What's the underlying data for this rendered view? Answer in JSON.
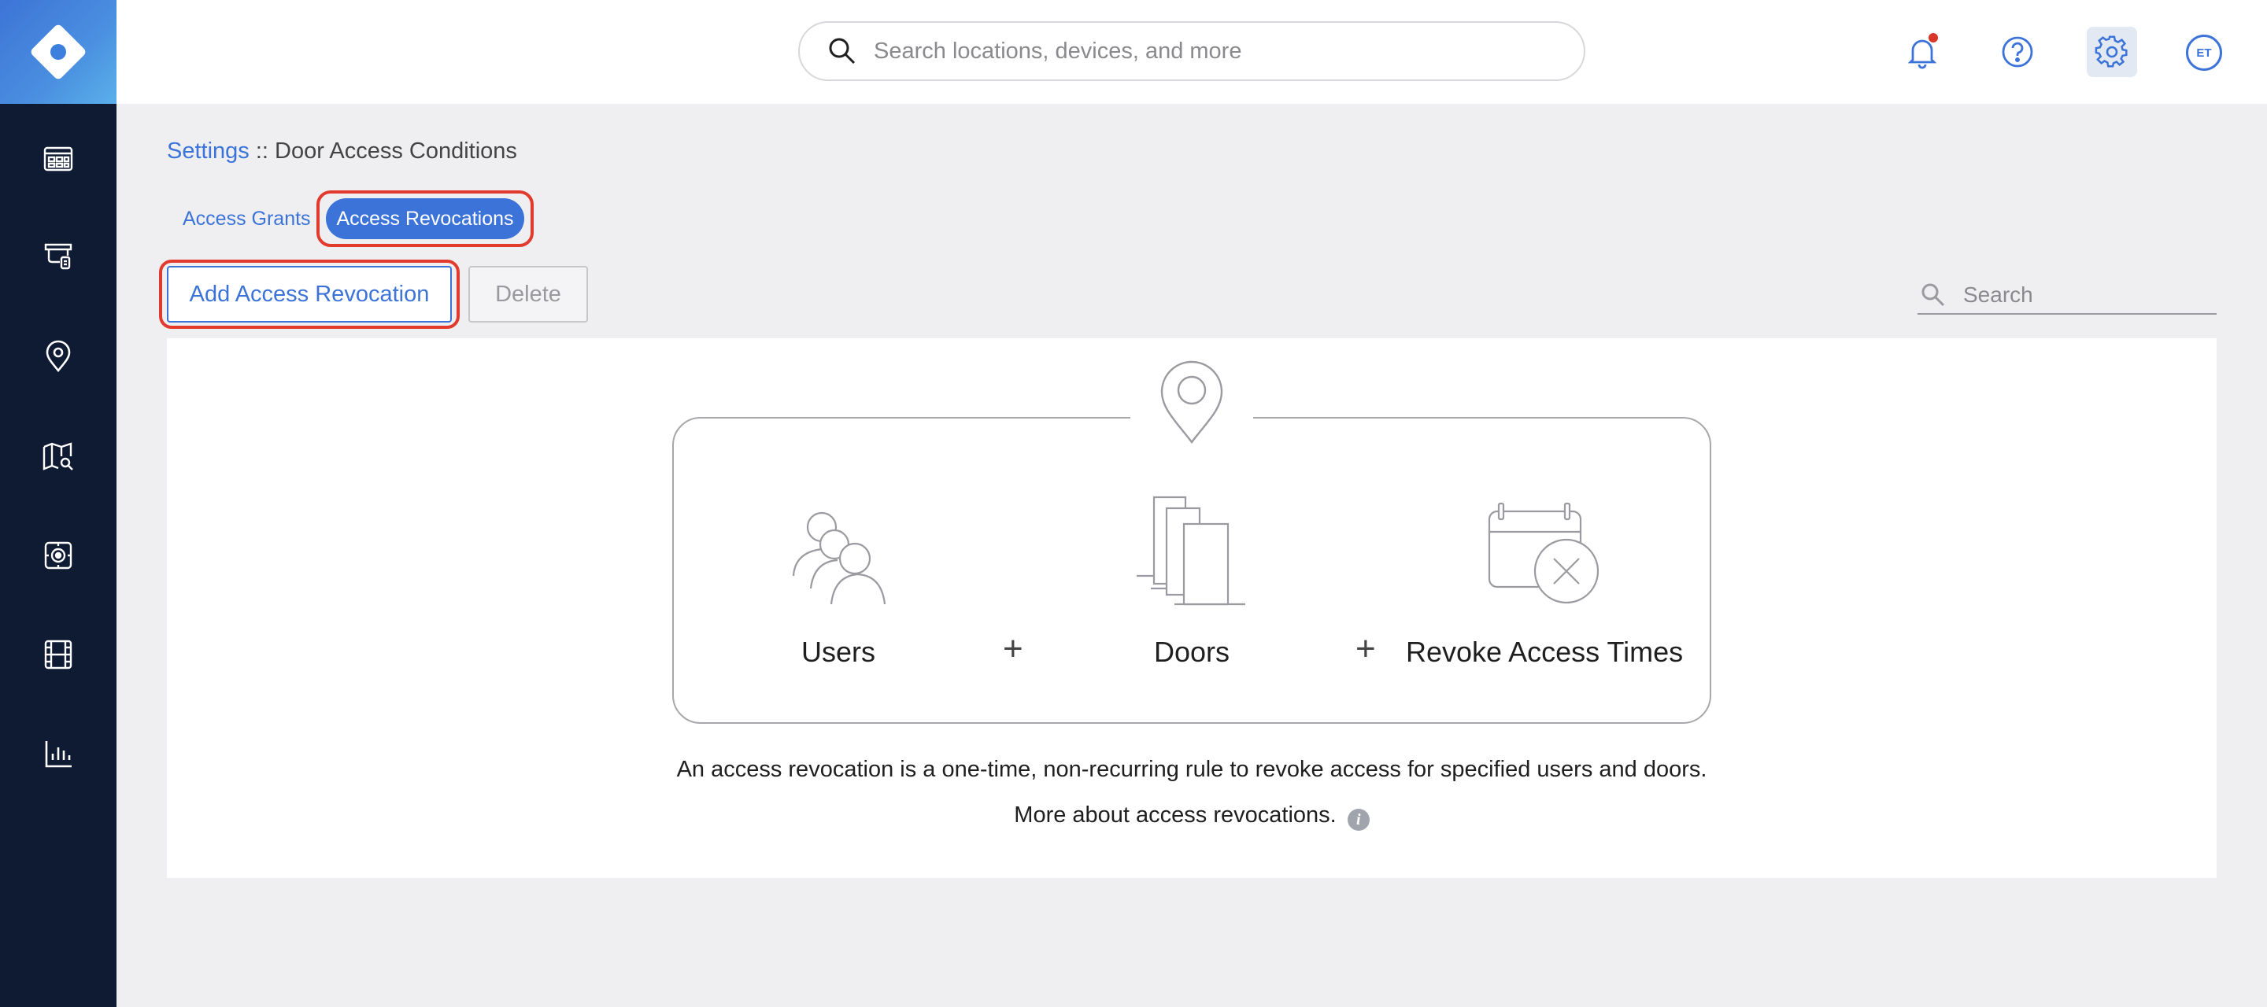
{
  "header": {
    "search_placeholder": "Search locations, devices, and more",
    "avatar_initials": "ET"
  },
  "breadcrumb": {
    "root": "Settings",
    "separator": " :: ",
    "current": "Door Access Conditions"
  },
  "tabs": [
    {
      "label": "Access Grants",
      "active": false
    },
    {
      "label": "Access Revocations",
      "active": true
    }
  ],
  "actions": {
    "add_label": "Add Access Revocation",
    "delete_label": "Delete"
  },
  "filter": {
    "placeholder": "Search"
  },
  "diagram": {
    "users_label": "Users",
    "doors_label": "Doors",
    "times_label": "Revoke Access Times",
    "plus": "+"
  },
  "description": {
    "line1": "An access revocation is a one-time, non-recurring rule to revoke access for specified users and doors.",
    "line2": "More about access revocations.",
    "info_glyph": "i"
  },
  "colors": {
    "sidebar": "#0f1a33",
    "accent": "#3b73d9",
    "highlight": "#e23a2c",
    "notification": "#d9352a"
  },
  "icons": {
    "sidebar": [
      "dashboard-icon",
      "devices-icon",
      "location-pin-icon",
      "map-search-icon",
      "camera-icon",
      "film-icon",
      "bar-chart-icon"
    ],
    "header": [
      "bell-icon",
      "help-icon",
      "gear-icon"
    ]
  }
}
